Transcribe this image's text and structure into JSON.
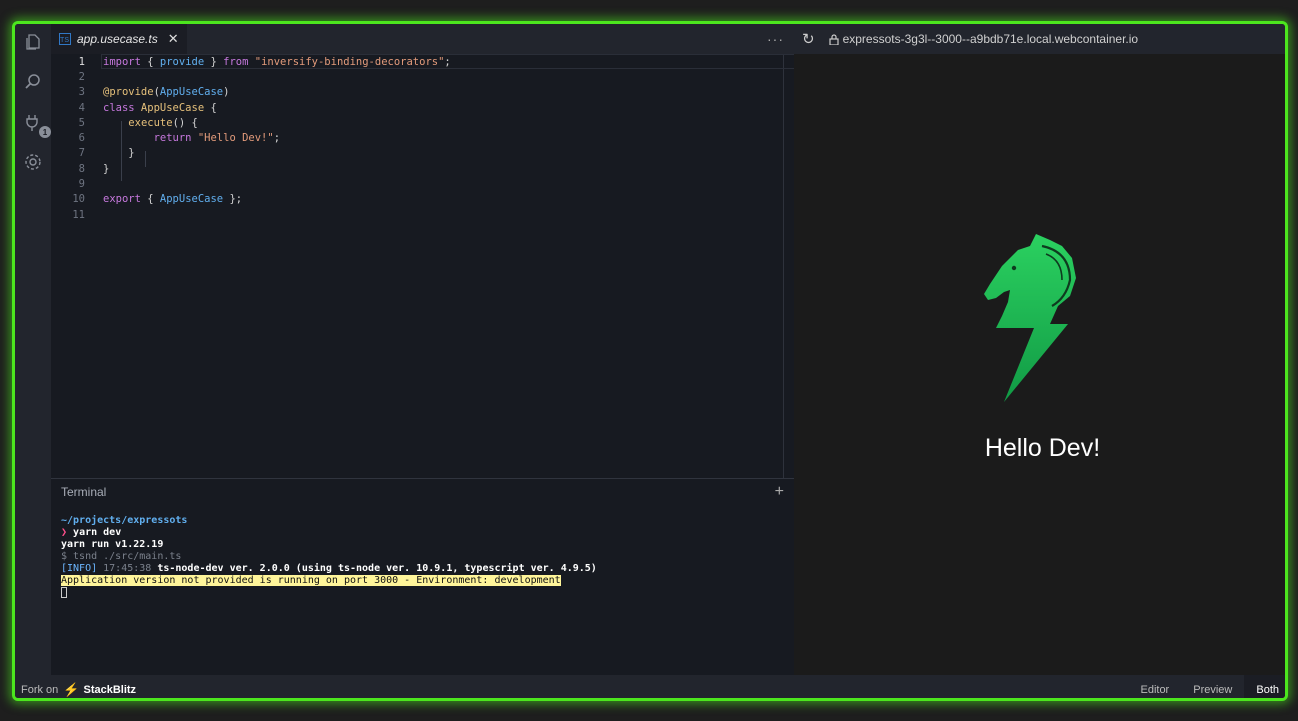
{
  "editor": {
    "tab_label": "app.usecase.ts",
    "tab_icon": "TS",
    "close_glyph": "✕",
    "more_glyph": "···",
    "lines": [
      {
        "n": "1"
      },
      {
        "n": "2"
      },
      {
        "n": "3"
      },
      {
        "n": "4"
      },
      {
        "n": "5"
      },
      {
        "n": "6"
      },
      {
        "n": "7"
      },
      {
        "n": "8"
      },
      {
        "n": "9"
      },
      {
        "n": "10"
      },
      {
        "n": "11"
      }
    ],
    "code": {
      "l1_import": "import",
      "l1_a": " { ",
      "l1_provide": "provide",
      "l1_b": " } ",
      "l1_from": "from",
      "l1_str": " \"inversify-binding-decorators\"",
      "l1_semi": ";",
      "l3_dec": "@provide",
      "l3_a": "(",
      "l3_cls": "AppUseCase",
      "l3_b": ")",
      "l4_class": "class",
      "l4_cls": " AppUseCase",
      "l4_b": " {",
      "l5_fn": "execute",
      "l5_b": "() {",
      "l6_return": "return",
      "l6_str": " \"Hello Dev!\"",
      "l6_semi": ";",
      "l7": "}",
      "l8": "}",
      "l10_export": "export",
      "l10_a": " { ",
      "l10_cls": "AppUseCase",
      "l10_b": " };"
    }
  },
  "terminal": {
    "title": "Terminal",
    "add_glyph": "+",
    "path": "~/projects/expressots",
    "prompt_glyph": "❯",
    "command": " yarn dev",
    "yarn_line": "yarn run v1.22.19",
    "tsnd_line": "$ tsnd ./src/main.ts",
    "info_tag": "[INFO]",
    "info_time": " 17:45:38",
    "info_msg": " ts-node-dev ver. 2.0.0 (using ts-node ver. 10.9.1, typescript ver. 4.9.5)",
    "app_msg": "Application version not provided is running on port 3000 - Environment: development"
  },
  "preview": {
    "reload_glyph": "↻",
    "url": "expressots-3g3l--3000--a9bdb71e.local.webcontainer.io",
    "heading": "Hello Dev!"
  },
  "footer": {
    "fork_label": "Fork on",
    "brand": "StackBlitz",
    "modes": [
      "Editor",
      "Preview",
      "Both"
    ],
    "active_mode": "Both"
  },
  "colors": {
    "frame_glow": "#4ce61e",
    "logo_green": "#22c55e",
    "logo_dark_green": "#15803d"
  },
  "icons": {
    "activity": [
      "files-icon",
      "search-icon",
      "plug-icon",
      "gear-icon"
    ],
    "plug_badge": "1"
  }
}
